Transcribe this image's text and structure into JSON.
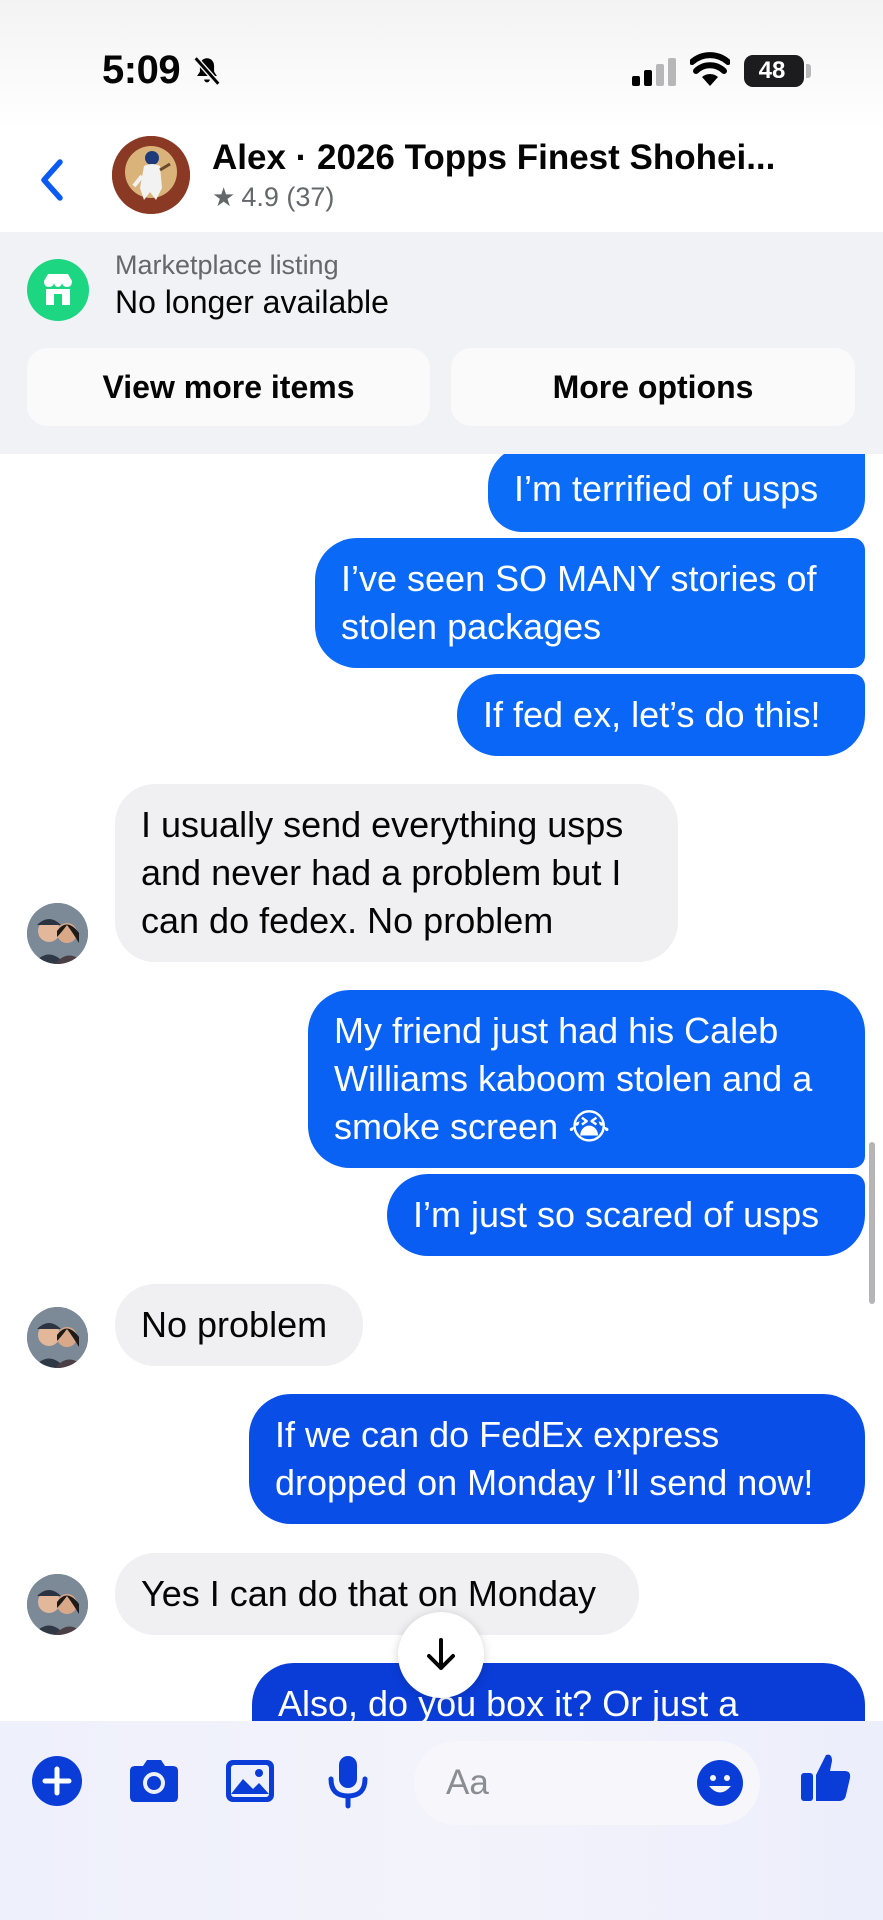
{
  "status_bar": {
    "time": "5:09",
    "battery": "48"
  },
  "header": {
    "title": "Alex · 2026 Topps Finest Shohei...",
    "rating_star": "★",
    "rating": "4.9 (37)"
  },
  "marketplace": {
    "label": "Marketplace listing",
    "status": "No longer available",
    "view_more_label": "View more items",
    "more_options_label": "More options"
  },
  "messages": [
    {
      "from": "me",
      "text": "I’m terrified of usps"
    },
    {
      "from": "me",
      "text": "I’ve seen SO MANY stories of stolen packages"
    },
    {
      "from": "me",
      "text": "If fed ex, let’s do this!"
    },
    {
      "from": "alex",
      "text": "I usually send everything usps and never had a problem but I can do fedex. No problem"
    },
    {
      "from": "me",
      "text": "My friend just had his Caleb Williams kaboom stolen and a smoke screen 😭"
    },
    {
      "from": "me",
      "text": "I’m just so scared of usps"
    },
    {
      "from": "alex",
      "text": "No problem"
    },
    {
      "from": "me",
      "text": "If we can do FedEx express dropped on Monday I’ll send now!"
    },
    {
      "from": "alex",
      "text": "Yes I can do that on Monday"
    },
    {
      "from": "me",
      "text": "Also, do you box it? Or just a"
    }
  ],
  "composer": {
    "placeholder": "Aa",
    "icons": [
      "plus-icon",
      "camera-icon",
      "gallery-icon",
      "microphone-icon",
      "emoji-icon",
      "thumbs-up-icon"
    ]
  },
  "colors": {
    "accent": "#0a5bf6",
    "bubble_out_light": "#0a6cf8",
    "bubble_out_dark": "#0a3ed8",
    "bubble_in": "#f0f0f2",
    "store_green": "#1dd682"
  }
}
